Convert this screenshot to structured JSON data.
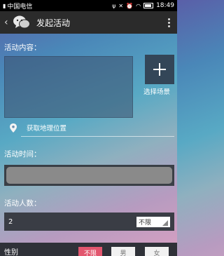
{
  "statusbar": {
    "carrier": "中国电信",
    "time": "18:49",
    "icons": [
      "signal-icon",
      "usb-icon",
      "mute-icon",
      "alarm-icon",
      "wifi-icon",
      "battery-icon"
    ]
  },
  "titlebar": {
    "title": "发起活动",
    "back_icon": "back-chevron-icon",
    "menu_icon": "overflow-menu-icon"
  },
  "form": {
    "content_label": "活动内容：",
    "add_scene_label": "选择场景",
    "location_text": "获取地理位置",
    "time_label": "活动时间：",
    "time_value": "",
    "count_label": "活动人数：",
    "count_value": "2",
    "limit_option": "不限",
    "gender_label": "性别",
    "gender_options": [
      "不限",
      "男",
      "女"
    ],
    "gender_selected": "不限"
  },
  "colors": {
    "titlebar_bg": "#2b2b2b",
    "accent_pink": "#e2566e",
    "add_button_bg": "#334658"
  }
}
